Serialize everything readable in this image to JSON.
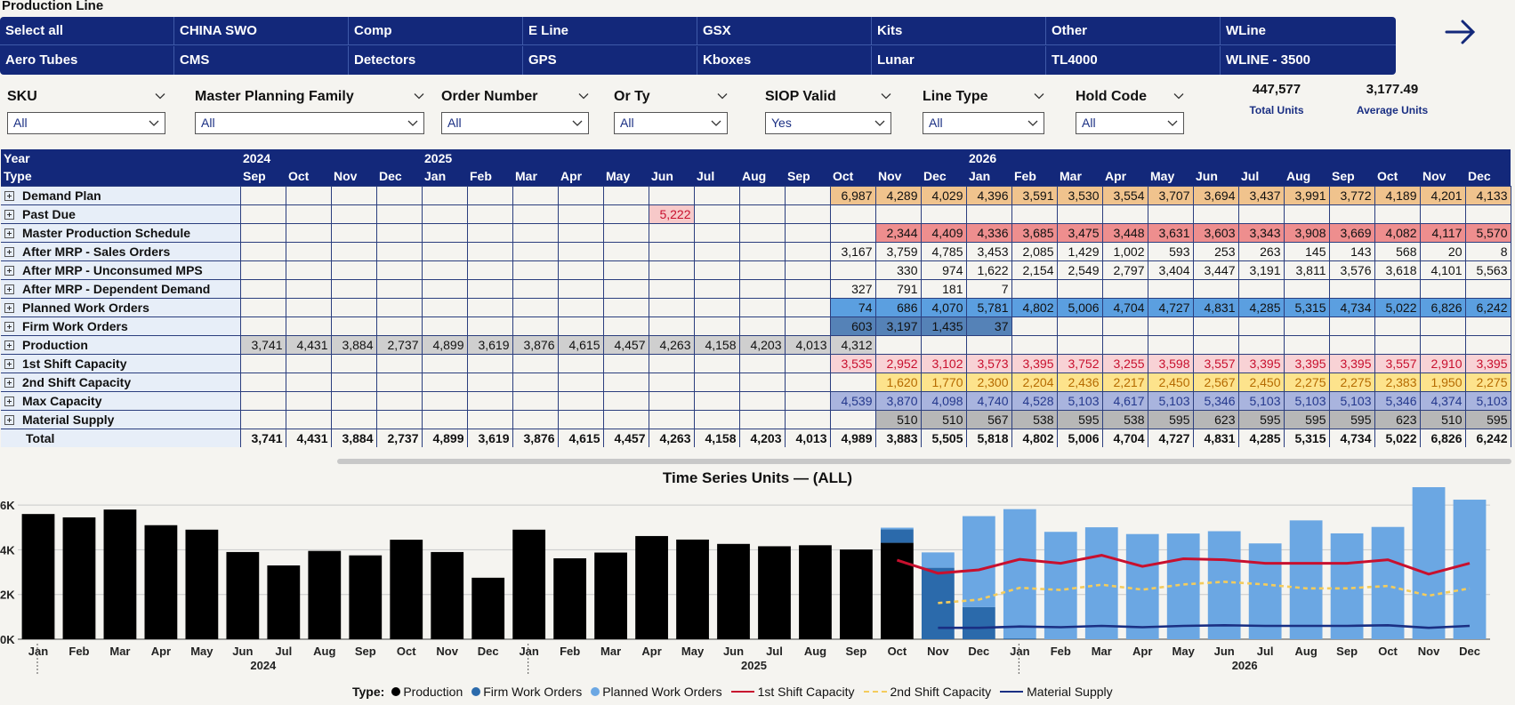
{
  "page": {
    "title": "Production Line"
  },
  "slicer": {
    "row1": [
      "Select all",
      "CHINA SWO",
      "Comp",
      "E Line",
      "GSX",
      "Kits",
      "Other",
      "WLine"
    ],
    "row2": [
      "Aero Tubes",
      "CMS",
      "Detectors",
      "GPS",
      "Kboxes",
      "Lunar",
      "TL4000",
      "WLINE - 3500"
    ]
  },
  "filters": [
    {
      "label": "SKU",
      "value": "All"
    },
    {
      "label": "Master Planning Family",
      "value": "All"
    },
    {
      "label": "Order Number",
      "value": "All"
    },
    {
      "label": "Or Ty",
      "value": "All"
    },
    {
      "label": "SIOP Valid",
      "value": "Yes"
    },
    {
      "label": "Line Type",
      "value": "All"
    },
    {
      "label": "Hold Code",
      "value": "All"
    }
  ],
  "kpis": [
    {
      "value": "447,577",
      "label": "Total Units"
    },
    {
      "value": "3,177.49",
      "label": "Average Units"
    }
  ],
  "matrix": {
    "year_label": "Year",
    "type_label": "Type",
    "years": [
      {
        "label": "2024",
        "span": 4
      },
      {
        "label": "2025",
        "span": 12
      },
      {
        "label": "2026",
        "span": 12
      }
    ],
    "months": [
      "Sep",
      "Oct",
      "Nov",
      "Dec",
      "Jan",
      "Feb",
      "Mar",
      "Apr",
      "May",
      "Jun",
      "Jul",
      "Aug",
      "Sep",
      "Oct",
      "Nov",
      "Dec",
      "Jan",
      "Feb",
      "Mar",
      "Apr",
      "May",
      "Jun",
      "Jul",
      "Aug",
      "Sep",
      "Oct",
      "Nov",
      "Dec"
    ],
    "rows": [
      {
        "label": "Demand Plan",
        "style": "demand",
        "cells": [
          "",
          "",
          "",
          "",
          "",
          "",
          "",
          "",
          "",
          "",
          "",
          "",
          "",
          "6,987",
          "4,289",
          "4,029",
          "4,396",
          "3,591",
          "3,530",
          "3,554",
          "3,707",
          "3,694",
          "3,437",
          "3,991",
          "3,772",
          "4,189",
          "4,201",
          "4,133"
        ]
      },
      {
        "label": "Past Due",
        "style": "pastdue",
        "cells": [
          "",
          "",
          "",
          "",
          "",
          "",
          "",
          "",
          "",
          "5,222",
          "",
          "",
          "",
          "",
          "",
          "",
          "",
          "",
          "",
          "",
          "",
          "",
          "",
          "",
          "",
          "",
          "",
          ""
        ]
      },
      {
        "label": "Master Production Schedule",
        "style": "mps",
        "cells": [
          "",
          "",
          "",
          "",
          "",
          "",
          "",
          "",
          "",
          "",
          "",
          "",
          "",
          "",
          "2,344",
          "4,409",
          "4,336",
          "3,685",
          "3,475",
          "3,448",
          "3,631",
          "3,603",
          "3,343",
          "3,908",
          "3,669",
          "4,082",
          "4,117",
          "5,570"
        ]
      },
      {
        "label": "After MRP - Sales Orders",
        "style": "plain",
        "cells": [
          "",
          "",
          "",
          "",
          "",
          "",
          "",
          "",
          "",
          "",
          "",
          "",
          "",
          "3,167",
          "3,759",
          "4,785",
          "3,453",
          "2,085",
          "1,429",
          "1,002",
          "593",
          "253",
          "263",
          "145",
          "143",
          "568",
          "20",
          "8"
        ]
      },
      {
        "label": "After MRP - Unconsumed MPS",
        "style": "plain",
        "cells": [
          "",
          "",
          "",
          "",
          "",
          "",
          "",
          "",
          "",
          "",
          "",
          "",
          "",
          "",
          "330",
          "974",
          "1,622",
          "2,154",
          "2,549",
          "2,797",
          "3,404",
          "3,447",
          "3,191",
          "3,811",
          "3,576",
          "3,618",
          "4,101",
          "5,563"
        ]
      },
      {
        "label": "After MRP - Dependent Demand",
        "style": "plain",
        "cells": [
          "",
          "",
          "",
          "",
          "",
          "",
          "",
          "",
          "",
          "",
          "",
          "",
          "",
          "327",
          "791",
          "181",
          "7",
          "",
          "",
          "",
          "",
          "",
          "",
          "",
          "",
          "",
          "",
          ""
        ]
      },
      {
        "label": "Planned Work Orders",
        "style": "pwo",
        "cells": [
          "",
          "",
          "",
          "",
          "",
          "",
          "",
          "",
          "",
          "",
          "",
          "",
          "",
          "74",
          "686",
          "4,070",
          "5,781",
          "4,802",
          "5,006",
          "4,704",
          "4,727",
          "4,831",
          "4,285",
          "5,315",
          "4,734",
          "5,022",
          "6,826",
          "6,242"
        ]
      },
      {
        "label": "Firm Work Orders",
        "style": "fwo",
        "cells": [
          "",
          "",
          "",
          "",
          "",
          "",
          "",
          "",
          "",
          "",
          "",
          "",
          "",
          "603",
          "3,197",
          "1,435",
          "37",
          "",
          "",
          "",
          "",
          "",
          "",
          "",
          "",
          "",
          "",
          ""
        ]
      },
      {
        "label": "Production",
        "style": "prod",
        "cells": [
          "3,741",
          "4,431",
          "3,884",
          "2,737",
          "4,899",
          "3,619",
          "3,876",
          "4,615",
          "4,457",
          "4,263",
          "4,158",
          "4,203",
          "4,013",
          "4,312",
          "",
          "",
          "",
          "",
          "",
          "",
          "",
          "",
          "",
          "",
          "",
          "",
          "",
          ""
        ]
      },
      {
        "label": "1st Shift Capacity",
        "style": "cap1",
        "cells": [
          "",
          "",
          "",
          "",
          "",
          "",
          "",
          "",
          "",
          "",
          "",
          "",
          "",
          "3,535",
          "2,952",
          "3,102",
          "3,573",
          "3,395",
          "3,752",
          "3,255",
          "3,598",
          "3,557",
          "3,395",
          "3,395",
          "3,395",
          "3,557",
          "2,910",
          "3,395"
        ]
      },
      {
        "label": "2nd Shift Capacity",
        "style": "cap2",
        "cells": [
          "",
          "",
          "",
          "",
          "",
          "",
          "",
          "",
          "",
          "",
          "",
          "",
          "",
          "",
          "1,620",
          "1,770",
          "2,300",
          "2,204",
          "2,436",
          "2,217",
          "2,450",
          "2,567",
          "2,450",
          "2,275",
          "2,275",
          "2,383",
          "1,950",
          "2,275"
        ]
      },
      {
        "label": "Max Capacity",
        "style": "maxcap",
        "cells": [
          "",
          "",
          "",
          "",
          "",
          "",
          "",
          "",
          "",
          "",
          "",
          "",
          "",
          "4,539",
          "3,870",
          "4,098",
          "4,740",
          "4,528",
          "5,103",
          "4,617",
          "5,103",
          "5,346",
          "5,103",
          "5,103",
          "5,103",
          "5,346",
          "4,374",
          "5,103"
        ]
      },
      {
        "label": "Material Supply",
        "style": "matsup",
        "cells": [
          "",
          "",
          "",
          "",
          "",
          "",
          "",
          "",
          "",
          "",
          "",
          "",
          "",
          "",
          "510",
          "510",
          "567",
          "538",
          "595",
          "538",
          "595",
          "623",
          "595",
          "595",
          "595",
          "623",
          "510",
          "595"
        ]
      }
    ],
    "total": {
      "label": "Total",
      "cells": [
        "3,741",
        "4,431",
        "3,884",
        "2,737",
        "4,899",
        "3,619",
        "3,876",
        "4,615",
        "4,457",
        "4,263",
        "4,158",
        "4,203",
        "4,013",
        "4,989",
        "3,883",
        "5,505",
        "5,818",
        "4,802",
        "5,006",
        "4,704",
        "4,727",
        "4,831",
        "4,285",
        "5,315",
        "4,734",
        "5,022",
        "6,826",
        "6,242"
      ]
    }
  },
  "colors": {
    "demand": "#f0c38d",
    "pastdue": "#f7c9c9",
    "pastdue_text": "#c8102e",
    "mps": "#ee8e8e",
    "pwo": "#5b9fe0",
    "fwo": "#5582b7",
    "prod": "#cfcfcf",
    "cap1": "#f8d2d5",
    "cap1_text": "#c8102e",
    "cap2": "#fde38c",
    "cap2_text": "#b56a00",
    "maxcap": "#a9b4de",
    "maxcap_text": "#24388c",
    "matsup": "#b7b7b7",
    "header": "#13287a"
  },
  "chart_data": {
    "type": "bar",
    "title": "Time Series Units — (ALL)",
    "x_months": [
      "Jan",
      "Feb",
      "Mar",
      "Apr",
      "May",
      "Jun",
      "Jul",
      "Aug",
      "Sep",
      "Oct",
      "Nov",
      "Dec",
      "Jan",
      "Feb",
      "Mar",
      "Apr",
      "May",
      "Jun",
      "Jul",
      "Aug",
      "Sep",
      "Oct",
      "Nov",
      "Dec",
      "Jan",
      "Feb",
      "Mar",
      "Apr",
      "May",
      "Jun",
      "Jul",
      "Aug",
      "Sep",
      "Oct",
      "Nov",
      "Dec"
    ],
    "x_years": [
      {
        "label": "2024",
        "start": 0,
        "end": 11
      },
      {
        "label": "2025",
        "start": 12,
        "end": 23
      },
      {
        "label": "2026",
        "start": 24,
        "end": 35
      }
    ],
    "y_ticks": [
      "0K",
      "2K",
      "4K",
      "6K"
    ],
    "ylim": [
      0,
      6800
    ],
    "series": [
      {
        "name": "Production",
        "kind": "bar",
        "color": "#000000",
        "values": [
          5600,
          5450,
          5800,
          5100,
          4900,
          3900,
          3300,
          3950,
          3750,
          4450,
          3900,
          2750,
          4899,
          3619,
          3876,
          4615,
          4457,
          4263,
          4158,
          4203,
          4013,
          4312,
          0,
          0,
          0,
          0,
          0,
          0,
          0,
          0,
          0,
          0,
          0,
          0,
          0,
          0
        ]
      },
      {
        "name": "Firm Work Orders",
        "kind": "bar",
        "color": "#2b6aab",
        "values": [
          0,
          0,
          0,
          0,
          0,
          0,
          0,
          0,
          0,
          0,
          0,
          0,
          0,
          0,
          0,
          0,
          0,
          0,
          0,
          0,
          0,
          603,
          3197,
          1435,
          37,
          0,
          0,
          0,
          0,
          0,
          0,
          0,
          0,
          0,
          0,
          0
        ]
      },
      {
        "name": "Planned Work Orders",
        "kind": "bar",
        "color": "#6ba7e3",
        "values": [
          0,
          0,
          0,
          0,
          0,
          0,
          0,
          0,
          0,
          0,
          0,
          0,
          0,
          0,
          0,
          0,
          0,
          0,
          0,
          0,
          0,
          74,
          686,
          4070,
          5781,
          4802,
          5006,
          4704,
          4727,
          4831,
          4285,
          5315,
          4734,
          5022,
          6826,
          6242
        ]
      },
      {
        "name": "1st Shift Capacity",
        "kind": "line",
        "color": "#c8102e",
        "values": [
          null,
          null,
          null,
          null,
          null,
          null,
          null,
          null,
          null,
          null,
          null,
          null,
          null,
          null,
          null,
          null,
          null,
          null,
          null,
          null,
          null,
          3535,
          2952,
          3102,
          3573,
          3395,
          3752,
          3255,
          3598,
          3557,
          3395,
          3395,
          3395,
          3557,
          2910,
          3395
        ]
      },
      {
        "name": "2nd Shift Capacity",
        "kind": "dashed",
        "color": "#f4cc5c",
        "values": [
          null,
          null,
          null,
          null,
          null,
          null,
          null,
          null,
          null,
          null,
          null,
          null,
          null,
          null,
          null,
          null,
          null,
          null,
          null,
          null,
          null,
          null,
          1620,
          1770,
          2300,
          2204,
          2436,
          2217,
          2450,
          2567,
          2450,
          2275,
          2275,
          2383,
          1950,
          2275
        ]
      },
      {
        "name": "Material Supply",
        "kind": "line",
        "color": "#1a2f83",
        "values": [
          null,
          null,
          null,
          null,
          null,
          null,
          null,
          null,
          null,
          null,
          null,
          null,
          null,
          null,
          null,
          null,
          null,
          null,
          null,
          null,
          null,
          null,
          510,
          510,
          567,
          538,
          595,
          538,
          595,
          623,
          595,
          595,
          595,
          623,
          510,
          595
        ]
      }
    ],
    "legend_title": "Type:"
  }
}
